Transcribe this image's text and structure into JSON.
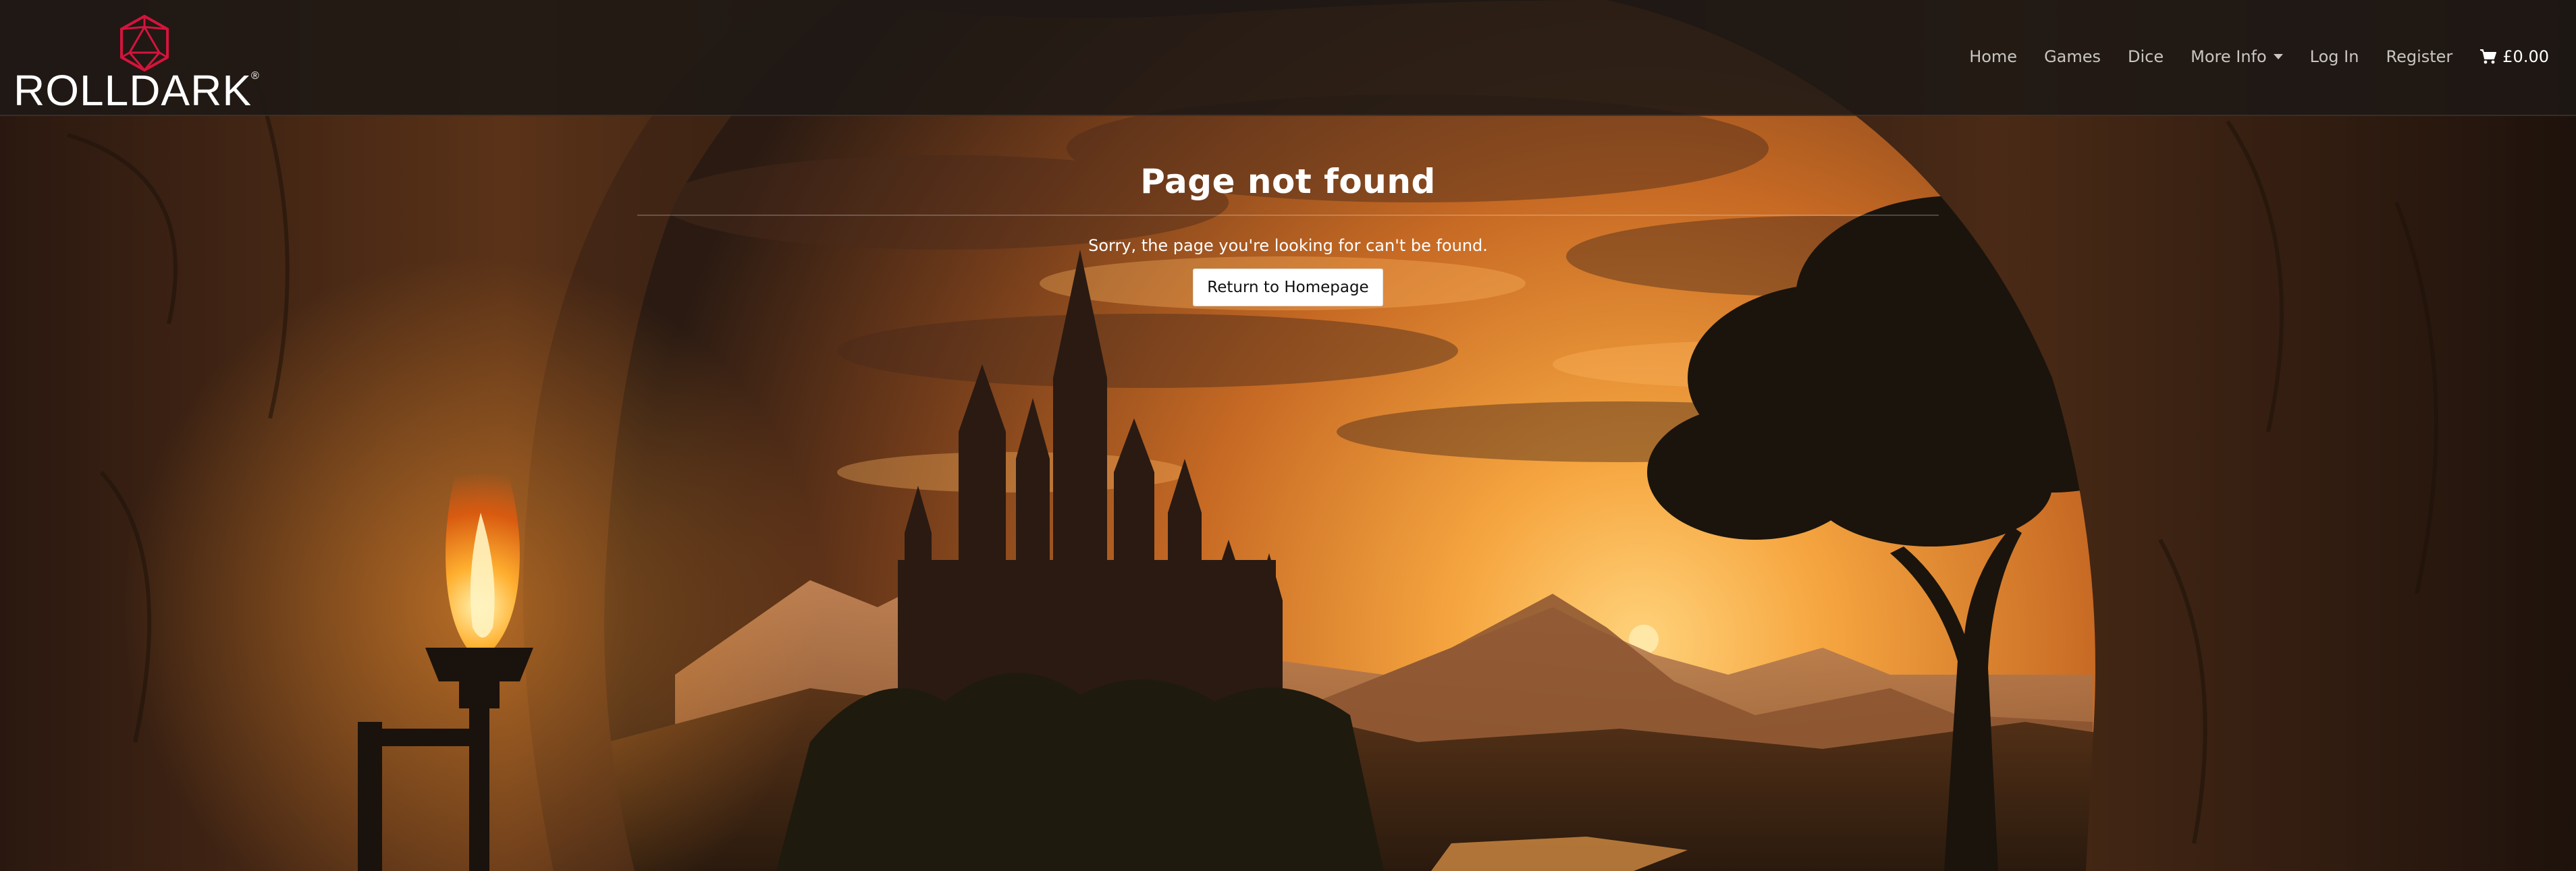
{
  "brand": {
    "name": "ROLLDARK",
    "registered_mark": "®",
    "logo_icon": "d20-icon",
    "logo_color": "#d4143c"
  },
  "nav": {
    "items": [
      {
        "label": "Home"
      },
      {
        "label": "Games"
      },
      {
        "label": "Dice"
      },
      {
        "label": "More Info",
        "has_dropdown": true
      },
      {
        "label": "Log In"
      },
      {
        "label": "Register"
      }
    ],
    "cart": {
      "icon": "cart-icon",
      "label": "£0.00"
    }
  },
  "main": {
    "title": "Page not found",
    "message": "Sorry, the page you're looking for can't be found.",
    "button_label": "Return to Homepage"
  },
  "colors": {
    "navbar_bg": "#1e1814",
    "text": "#ffffff",
    "nav_text": "#c9c6c2",
    "sky_glow": "#f0902a"
  }
}
